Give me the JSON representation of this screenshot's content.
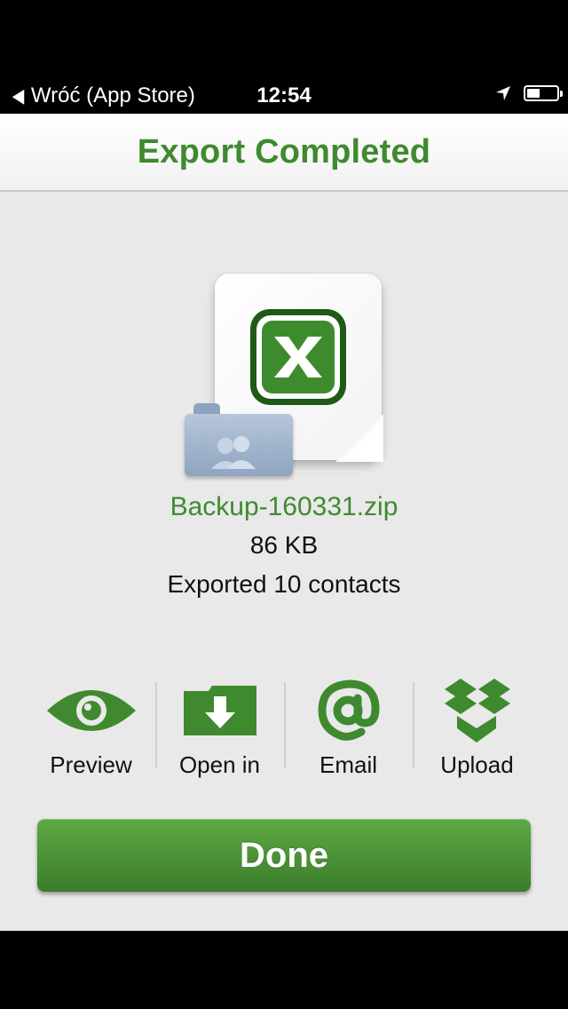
{
  "status_bar": {
    "back_label": "Wróć (App Store)",
    "time": "12:54",
    "battery_level": 0.45
  },
  "nav": {
    "title": "Export Completed"
  },
  "file": {
    "name": "Backup-160331.zip",
    "size": "86 KB",
    "status": "Exported 10 contacts"
  },
  "actions": [
    {
      "label": "Preview",
      "icon": "eye-icon"
    },
    {
      "label": "Open in",
      "icon": "folder-download-icon"
    },
    {
      "label": "Email",
      "icon": "at-sign-icon"
    },
    {
      "label": "Upload",
      "icon": "dropbox-icon"
    }
  ],
  "done_label": "Done",
  "colors": {
    "accent_green": "#3f8a2f",
    "background": "#e9e9e9",
    "button_top": "#5da944",
    "button_bottom": "#3b7d2b"
  }
}
